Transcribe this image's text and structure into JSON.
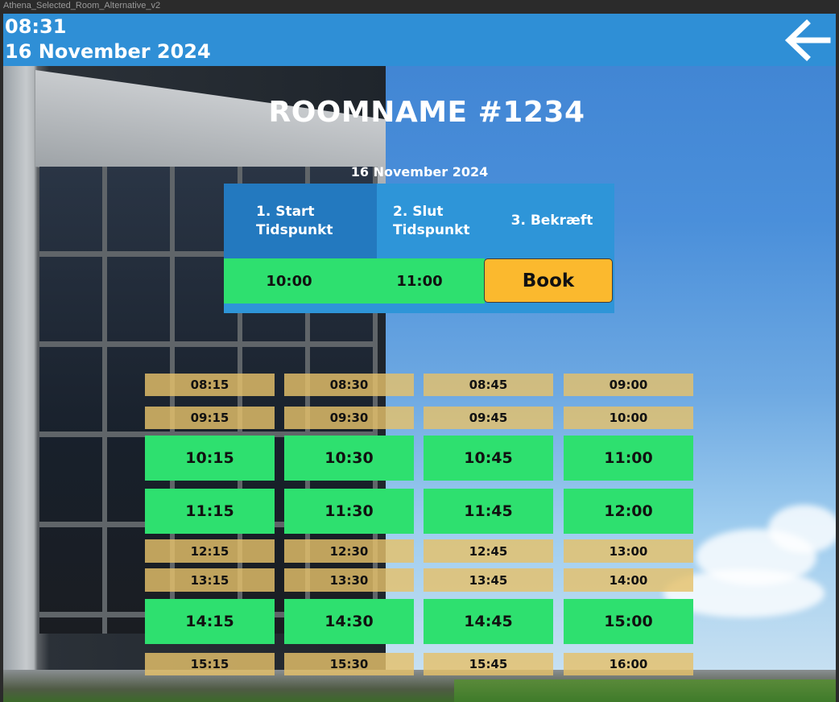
{
  "frame": {
    "title": "Athena_Selected_Room_Alternative_v2"
  },
  "header": {
    "time": "08:31",
    "date": "16 November 2024",
    "back_icon": "arrow-left-icon"
  },
  "room": {
    "name": "ROOMNAME #1234",
    "date": "16 November 2024"
  },
  "booking": {
    "steps": [
      {
        "label": "1. Start Tidspunkt",
        "active": true
      },
      {
        "label": "2. Slut Tidspunkt",
        "active": false
      },
      {
        "label": "3. Bekræft",
        "active": false
      }
    ],
    "start": "10:00",
    "end": "11:00",
    "book_label": "Book"
  },
  "colors": {
    "topbar": "#2f8fd6",
    "free": "#2ee06f",
    "taken": "#e5c16a",
    "book": "#fbb92e",
    "panel": "#2e95d8"
  },
  "slots": [
    [
      {
        "time": "08:15",
        "status": "taken"
      },
      {
        "time": "08:30",
        "status": "taken"
      },
      {
        "time": "08:45",
        "status": "taken"
      },
      {
        "time": "09:00",
        "status": "taken"
      }
    ],
    [
      {
        "time": "09:15",
        "status": "taken"
      },
      {
        "time": "09:30",
        "status": "taken"
      },
      {
        "time": "09:45",
        "status": "taken"
      },
      {
        "time": "10:00",
        "status": "taken"
      }
    ],
    [
      {
        "time": "10:15",
        "status": "free"
      },
      {
        "time": "10:30",
        "status": "free"
      },
      {
        "time": "10:45",
        "status": "free"
      },
      {
        "time": "11:00",
        "status": "free"
      }
    ],
    [
      {
        "time": "11:15",
        "status": "free"
      },
      {
        "time": "11:30",
        "status": "free"
      },
      {
        "time": "11:45",
        "status": "free"
      },
      {
        "time": "12:00",
        "status": "free"
      }
    ],
    [
      {
        "time": "12:15",
        "status": "taken"
      },
      {
        "time": "12:30",
        "status": "taken"
      },
      {
        "time": "12:45",
        "status": "taken"
      },
      {
        "time": "13:00",
        "status": "taken"
      }
    ],
    [
      {
        "time": "13:15",
        "status": "taken"
      },
      {
        "time": "13:30",
        "status": "taken"
      },
      {
        "time": "13:45",
        "status": "taken"
      },
      {
        "time": "14:00",
        "status": "taken"
      }
    ],
    [
      {
        "time": "14:15",
        "status": "free"
      },
      {
        "time": "14:30",
        "status": "free"
      },
      {
        "time": "14:45",
        "status": "free"
      },
      {
        "time": "15:00",
        "status": "free"
      }
    ],
    [
      {
        "time": "15:15",
        "status": "taken"
      },
      {
        "time": "15:30",
        "status": "taken"
      },
      {
        "time": "15:45",
        "status": "taken"
      },
      {
        "time": "16:00",
        "status": "taken"
      }
    ]
  ]
}
